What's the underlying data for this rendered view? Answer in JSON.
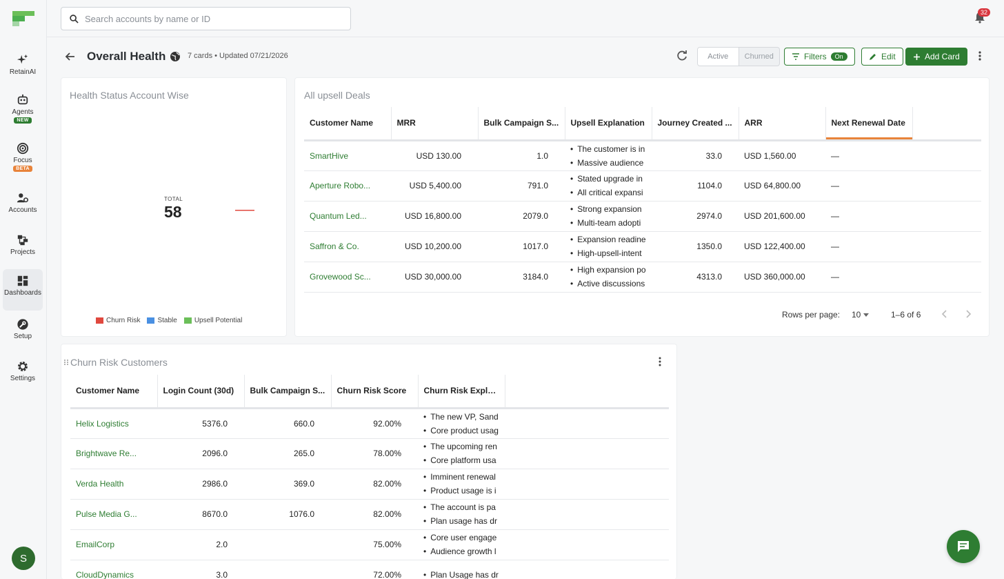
{
  "search": {
    "placeholder": "Search accounts by name or ID"
  },
  "notifications": {
    "count": "32"
  },
  "sidebar": {
    "items": [
      {
        "label": "RetainAI",
        "icon": "sparkle-icon"
      },
      {
        "label": "Agents",
        "icon": "robot-icon",
        "badge": "NEW"
      },
      {
        "label": "Focus",
        "icon": "target-icon",
        "badge": "BETA"
      },
      {
        "label": "Accounts",
        "icon": "accounts-icon"
      },
      {
        "label": "Projects",
        "icon": "projects-icon"
      },
      {
        "label": "Dashboards",
        "icon": "dashboard-icon"
      },
      {
        "label": "Setup",
        "icon": "wrench-icon"
      },
      {
        "label": "Settings",
        "icon": "gear-icon"
      }
    ],
    "avatar": "S"
  },
  "header": {
    "title": "Overall Health",
    "meta": "7 cards • Updated 07/21/2026",
    "toggle": {
      "active": "Active",
      "churned": "Churned"
    },
    "filters_label": "Filters",
    "filters_state": "On",
    "edit_label": "Edit",
    "add_card_label": "Add Card"
  },
  "health_card": {
    "title": "Health Status Account Wise",
    "total_label": "TOTAL",
    "total_value": "58",
    "legend": [
      {
        "label": "Churn Risk",
        "color": "#e0483e"
      },
      {
        "label": "Stable",
        "color": "#4a90e2"
      },
      {
        "label": "Upsell Potential",
        "color": "#6bbf59"
      }
    ]
  },
  "upsell_card": {
    "title": "All upsell Deals",
    "columns": [
      "Customer Name",
      "MRR",
      "Bulk Campaign S...",
      "Upsell Explanation",
      "Journey Created ...",
      "ARR",
      "Next Renewal Date"
    ],
    "rows": [
      {
        "name": "SmartHive",
        "mrr": "USD 130.00",
        "bulk": "1.0",
        "expl": [
          "The customer is in",
          "Massive audience"
        ],
        "journey": "33.0",
        "arr": "USD 1,560.00",
        "renewal": "—"
      },
      {
        "name": "Aperture Robo...",
        "mrr": "USD 5,400.00",
        "bulk": "791.0",
        "expl": [
          "Stated upgrade in",
          "All critical expansi"
        ],
        "journey": "1104.0",
        "arr": "USD 64,800.00",
        "renewal": "—"
      },
      {
        "name": "Quantum Led...",
        "mrr": "USD 16,800.00",
        "bulk": "2079.0",
        "expl": [
          "Strong expansion",
          "Multi-team adopti"
        ],
        "journey": "2974.0",
        "arr": "USD 201,600.00",
        "renewal": "—"
      },
      {
        "name": "Saffron & Co.",
        "mrr": "USD 10,200.00",
        "bulk": "1017.0",
        "expl": [
          "Expansion readine",
          "High-upsell-intent"
        ],
        "journey": "1350.0",
        "arr": "USD 122,400.00",
        "renewal": "—"
      },
      {
        "name": "Grovewood Sc...",
        "mrr": "USD 30,000.00",
        "bulk": "3184.0",
        "expl": [
          "High expansion po",
          "Active discussions"
        ],
        "journey": "4313.0",
        "arr": "USD 360,000.00",
        "renewal": "—"
      }
    ],
    "rows_per_page_label": "Rows per page:",
    "rows_per_page": "10",
    "range": "1–6 of 6"
  },
  "churn_card": {
    "title": "Churn Risk Customers",
    "columns": [
      "Customer Name",
      "Login Count (30d)",
      "Bulk Campaign S...",
      "Churn Risk Score",
      "Churn Risk Expla..."
    ],
    "rows": [
      {
        "name": "Helix Logistics",
        "login": "5376.0",
        "bulk": "660.0",
        "score": "92.00%",
        "expl": [
          "The new VP, Sand",
          "Core product usag"
        ]
      },
      {
        "name": "Brightwave Re...",
        "login": "2096.0",
        "bulk": "265.0",
        "score": "78.00%",
        "expl": [
          "The upcoming ren",
          "Core platform usa"
        ]
      },
      {
        "name": "Verda Health",
        "login": "2986.0",
        "bulk": "369.0",
        "score": "82.00%",
        "expl": [
          "Imminent renewal",
          "Product usage is i"
        ]
      },
      {
        "name": "Pulse Media G...",
        "login": "8670.0",
        "bulk": "1076.0",
        "score": "82.00%",
        "expl": [
          "The account is pa",
          "Plan usage has dr"
        ]
      },
      {
        "name": "EmailCorp",
        "login": "2.0",
        "bulk": "",
        "score": "75.00%",
        "expl": [
          "Core user engage",
          "Audience growth l"
        ]
      },
      {
        "name": "CloudDynamics",
        "login": "3.0",
        "bulk": "",
        "score": "72.00%",
        "expl": [
          "Plan Usage has dr",
          ""
        ]
      }
    ]
  }
}
